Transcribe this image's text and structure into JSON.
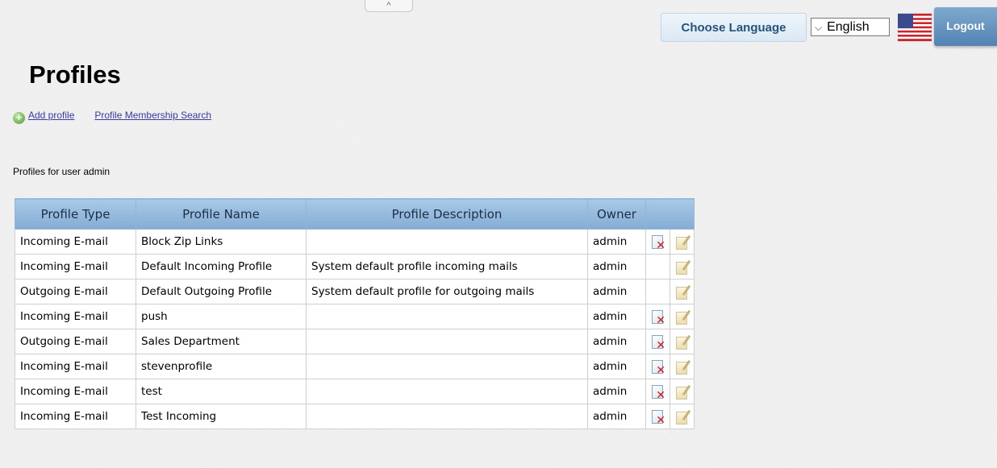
{
  "header": {
    "collapse_glyph": "^",
    "choose_language_label": "Choose Language",
    "language_selected": "English",
    "language_chevron": "⌵",
    "flag_icon": "us-flag-icon",
    "logout_label": "Logout"
  },
  "page": {
    "title": "Profiles",
    "add_icon_glyph": "+",
    "add_profile_label": "Add profile",
    "membership_search_label": "Profile Membership Search",
    "subtitle": "Profiles for user admin"
  },
  "table": {
    "headers": [
      "Profile Type",
      "Profile Name",
      "Profile Description",
      "Owner"
    ],
    "rows": [
      {
        "type": "Incoming E-mail",
        "name": "Block Zip Links",
        "description": "",
        "owner": "admin",
        "deletable": true
      },
      {
        "type": "Incoming E-mail",
        "name": "Default Incoming Profile",
        "description": "System default profile incoming mails",
        "owner": "admin",
        "deletable": false
      },
      {
        "type": "Outgoing E-mail",
        "name": "Default Outgoing Profile",
        "description": "System default profile for outgoing mails",
        "owner": "admin",
        "deletable": false
      },
      {
        "type": "Incoming E-mail",
        "name": "push",
        "description": "",
        "owner": "admin",
        "deletable": true
      },
      {
        "type": "Outgoing E-mail",
        "name": "Sales Department",
        "description": "",
        "owner": "admin",
        "deletable": true
      },
      {
        "type": "Incoming E-mail",
        "name": "stevenprofile",
        "description": "",
        "owner": "admin",
        "deletable": true
      },
      {
        "type": "Incoming E-mail",
        "name": "test",
        "description": "",
        "owner": "admin",
        "deletable": true
      },
      {
        "type": "Incoming E-mail",
        "name": "Test Incoming",
        "description": "",
        "owner": "admin",
        "deletable": true
      }
    ]
  },
  "colors": {
    "header_bg": "#84acd4",
    "logout_bg": "#5283b3",
    "link": "#3a3aa0"
  }
}
